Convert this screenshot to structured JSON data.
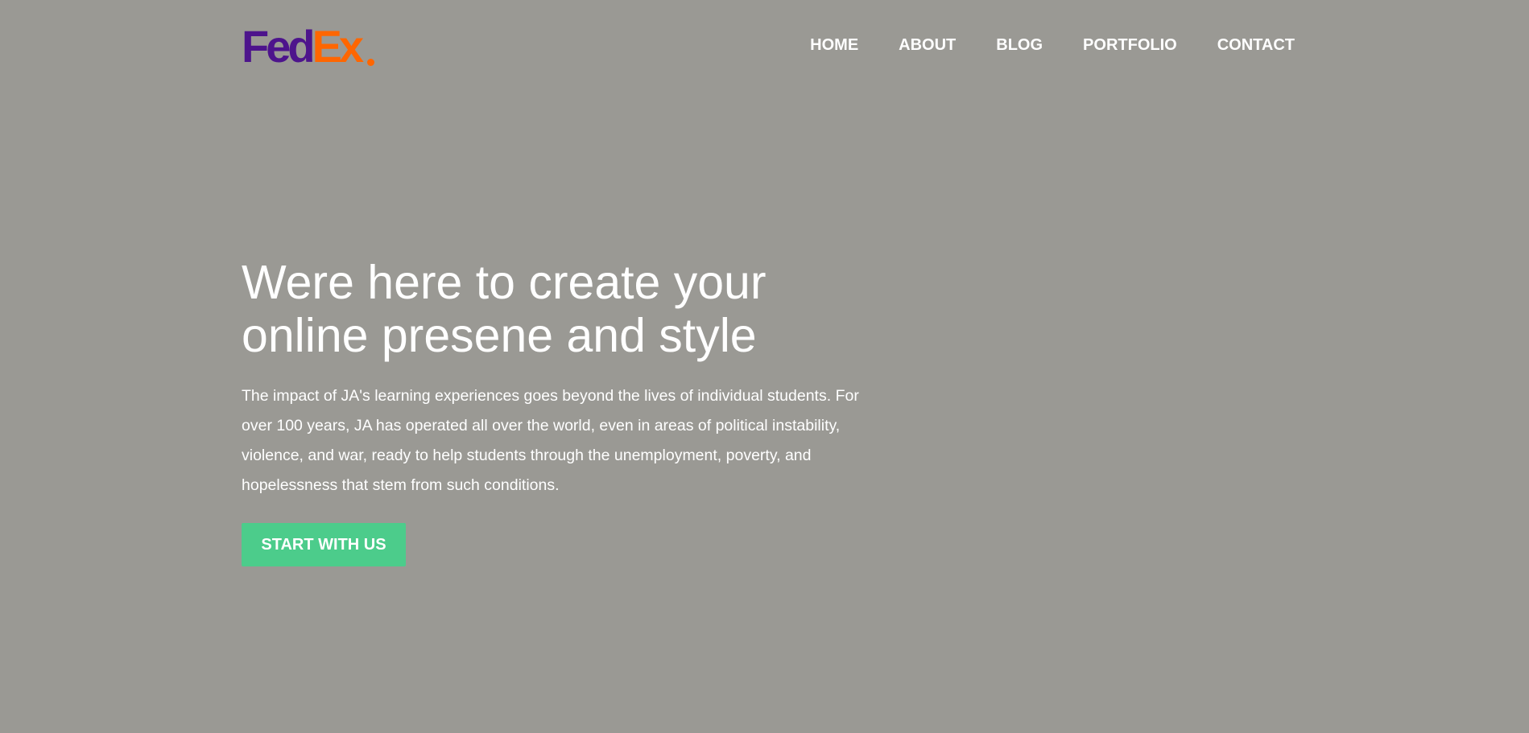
{
  "brand": {
    "logo_part1": "Fed",
    "logo_part2": "Ex",
    "colors": {
      "fed": "#4d148c",
      "ex": "#ff6600"
    }
  },
  "nav": {
    "items": [
      {
        "label": "HOME"
      },
      {
        "label": "ABOUT"
      },
      {
        "label": "BLOG"
      },
      {
        "label": "PORTFOLIO"
      },
      {
        "label": "CONTACT"
      }
    ]
  },
  "hero": {
    "title": "Were here to create your online presene and style",
    "description": "The impact of JA's learning experiences goes beyond the lives of individual students. For over 100 years, JA has operated all over the world, even in areas of political instability, violence, and war, ready to help students through the unemployment, poverty, and hopelessness that stem from such conditions.",
    "cta_label": "START WITH US"
  },
  "colors": {
    "background": "#9a9994",
    "text": "#ffffff",
    "cta": "#4ccc8b"
  }
}
